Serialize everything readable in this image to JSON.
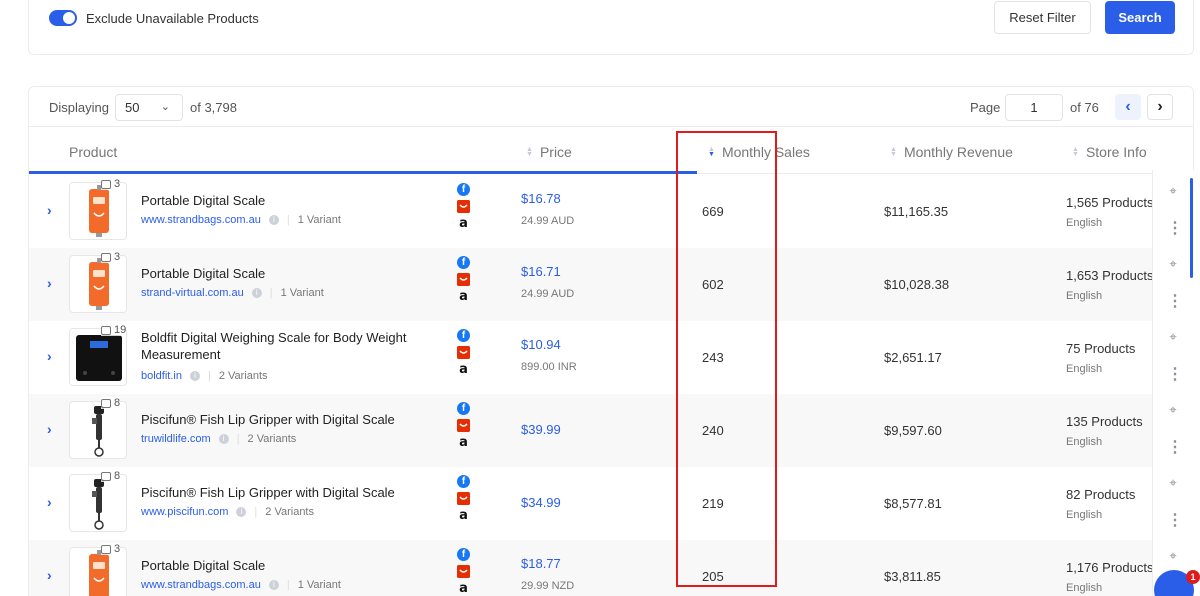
{
  "filters": {
    "exclude_unavailable_label": "Exclude Unavailable Products",
    "exclude_unavailable_on": true,
    "reset_label": "Reset Filter",
    "search_label": "Search"
  },
  "pagination": {
    "displaying_label": "Displaying",
    "per_page": "50",
    "of_total": "of 3,798",
    "page_label": "Page",
    "current_page": "1",
    "of_pages": "of 76"
  },
  "columns": {
    "product": "Product",
    "price": "Price",
    "monthly_sales": "Monthly Sales",
    "monthly_revenue": "Monthly Revenue",
    "store_info": "Store Info"
  },
  "rows": [
    {
      "image_count": "3",
      "title": "Portable Digital Scale",
      "store": "www.strandbags.com.au",
      "variants": "1 Variant",
      "price": "$16.78",
      "orig_price": "24.99 AUD",
      "sales": "669",
      "revenue": "$11,165.35",
      "store_products": "1,565 Products",
      "language": "English",
      "image_kind": "orange-scale"
    },
    {
      "image_count": "3",
      "title": "Portable Digital Scale",
      "store": "strand-virtual.com.au",
      "variants": "1 Variant",
      "price": "$16.71",
      "orig_price": "24.99 AUD",
      "sales": "602",
      "revenue": "$10,028.38",
      "store_products": "1,653 Products",
      "language": "English",
      "image_kind": "orange-scale"
    },
    {
      "image_count": "19",
      "title": "Boldfit Digital Weighing Scale for Body Weight Measurement",
      "store": "boldfit.in",
      "variants": "2 Variants",
      "price": "$10.94",
      "orig_price": "899.00 INR",
      "sales": "243",
      "revenue": "$2,651.17",
      "store_products": "75 Products",
      "language": "English",
      "image_kind": "black-scale"
    },
    {
      "image_count": "8",
      "title": "Piscifun® Fish Lip Gripper with Digital Scale",
      "store": "truwildlife.com",
      "variants": "2 Variants",
      "price": "$39.99",
      "orig_price": "",
      "sales": "240",
      "revenue": "$9,597.60",
      "store_products": "135 Products",
      "language": "English",
      "image_kind": "gripper"
    },
    {
      "image_count": "8",
      "title": "Piscifun® Fish Lip Gripper with Digital Scale",
      "store": "www.piscifun.com",
      "variants": "2 Variants",
      "price": "$34.99",
      "orig_price": "",
      "sales": "219",
      "revenue": "$8,577.81",
      "store_products": "82 Products",
      "language": "English",
      "image_kind": "gripper"
    },
    {
      "image_count": "3",
      "title": "Portable Digital Scale",
      "store": "www.strandbags.com.au",
      "variants": "1 Variant",
      "price": "$18.77",
      "orig_price": "29.99 NZD",
      "sales": "205",
      "revenue": "$3,811.85",
      "store_products": "1,176 Products",
      "language": "English",
      "image_kind": "orange-scale"
    }
  ],
  "icons": {
    "channel_1": "facebook-icon",
    "channel_2": "aliexpress-icon",
    "channel_3": "amazon-icon",
    "expand": "chevron-right-icon",
    "locate": "crosshair-icon",
    "more": "more-vertical-icon"
  },
  "chat": {
    "badge": "1"
  },
  "colors": {
    "accent": "#2b5ee8",
    "highlight": "#e01b1b",
    "alt_row": "#f8f8f8"
  }
}
